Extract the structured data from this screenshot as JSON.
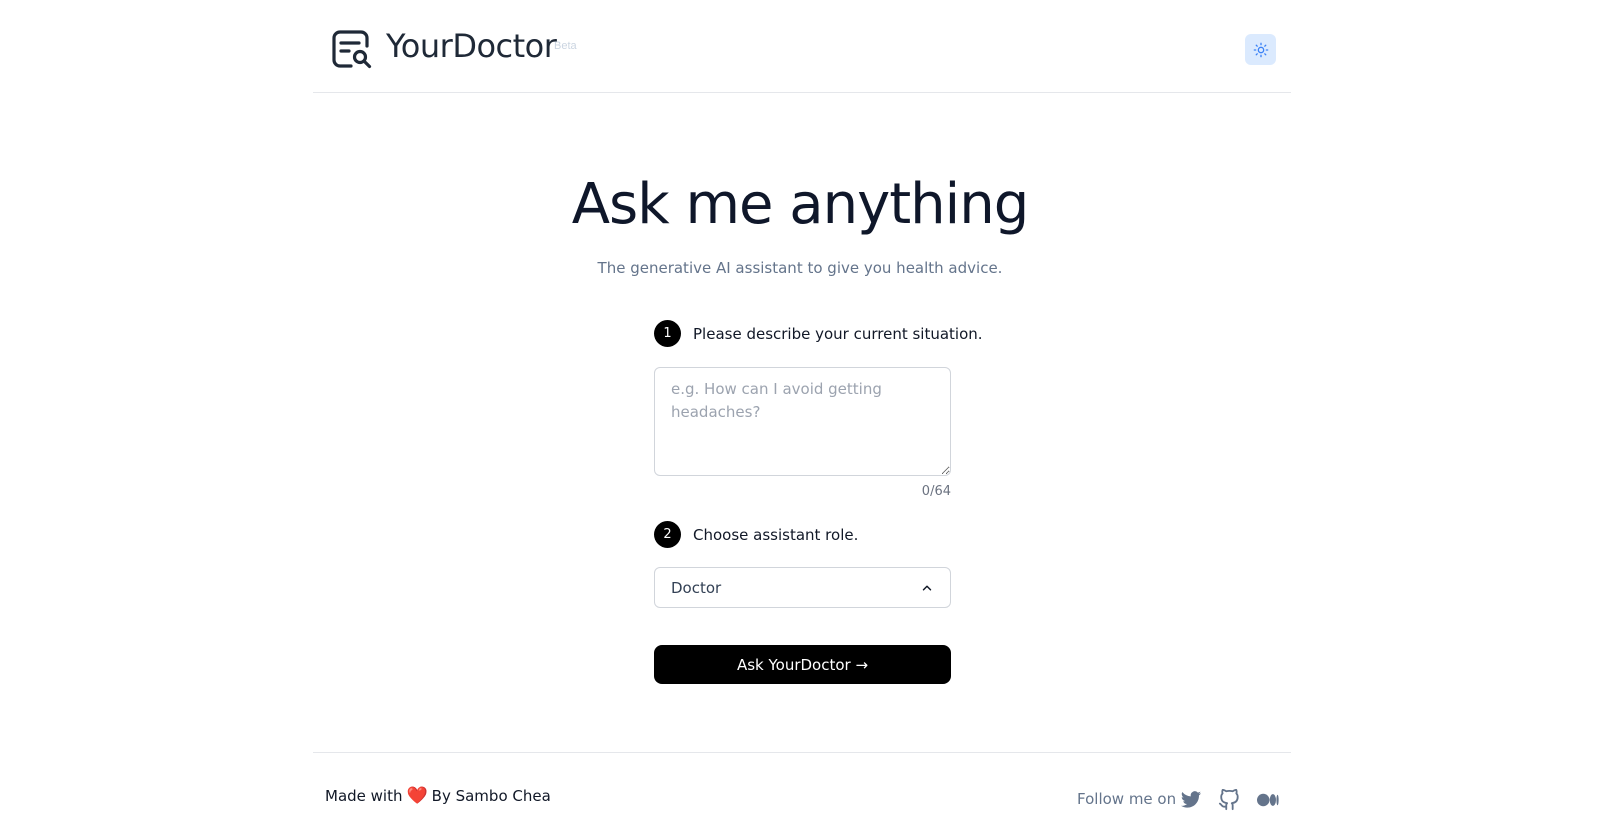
{
  "header": {
    "brand": "YourDoctor",
    "badge": "Beta",
    "theme_toggle_icon": "sun-icon"
  },
  "hero": {
    "title": "Ask me anything",
    "subtitle": "The generative AI assistant to give you health advice."
  },
  "form": {
    "step1": {
      "number": "1",
      "label": "Please describe your current situation."
    },
    "question": {
      "value": "",
      "placeholder": "e.g. How can I avoid getting headaches?",
      "counter": "0/64"
    },
    "step2": {
      "number": "2",
      "label": "Choose assistant role."
    },
    "role_select": {
      "selected": "Doctor"
    },
    "submit_label": "Ask YourDoctor →"
  },
  "footer": {
    "made_with_prefix": "Made with",
    "heart": "❤️",
    "made_with_suffix": "By Sambo Chea",
    "follow_label": "Follow me on",
    "social_icons": [
      "twitter-icon",
      "github-icon",
      "medium-icon"
    ]
  },
  "colors": {
    "accent_button": "#000000",
    "theme_toggle_bg": "#dbeafe",
    "theme_toggle_icon": "#3b82f6",
    "muted_text": "#64748b"
  }
}
